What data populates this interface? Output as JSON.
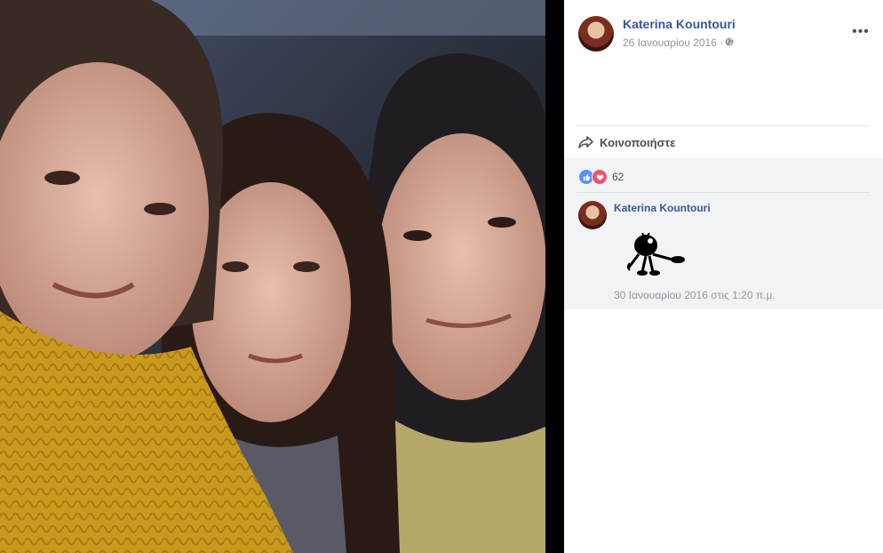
{
  "photo": {
    "description_icon": "photo-selfie"
  },
  "post": {
    "author_name": "Katerina Kountouri",
    "date": "26 Ιανουαρίου 2016 ·",
    "privacy_icon": "globe-icon",
    "more_label": "•••",
    "share_label": "Κοινοποιήστε"
  },
  "reactions": {
    "icons": [
      "like-icon",
      "love-icon"
    ],
    "count": "62"
  },
  "comment": {
    "author_name": "Katerina Kountouri",
    "sticker_icon": "sticker-icon",
    "timestamp": "30 Ιανουαρίου 2016 στις 1:20 π.μ."
  },
  "colors": {
    "link": "#365899",
    "meta": "#90949c",
    "like": "#5890ff",
    "love": "#f25268",
    "comment_bg": "#f2f3f5"
  }
}
